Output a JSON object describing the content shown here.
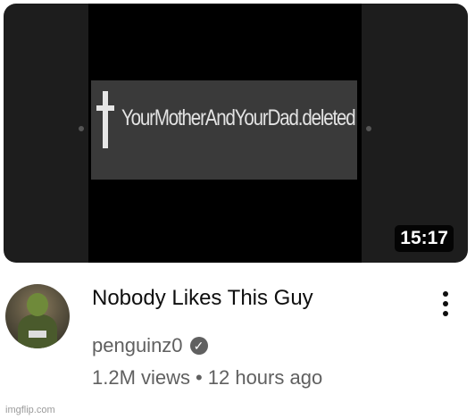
{
  "thumbnail": {
    "banner_text": "YourMotherAndYourDad.deleted",
    "duration": "15:17"
  },
  "video": {
    "title": "Nobody Likes This Guy",
    "channel": "penguinz0",
    "views": "1.2M views",
    "separator": "•",
    "age": "12 hours ago"
  },
  "icons": {
    "menu": "more-vert-icon",
    "verified": "verified-check-icon",
    "cross": "cross-icon"
  },
  "colors": {
    "duration_bg": "#000000",
    "title": "#0f0f0f",
    "secondary": "#606060"
  },
  "watermark": "imgflip.com"
}
